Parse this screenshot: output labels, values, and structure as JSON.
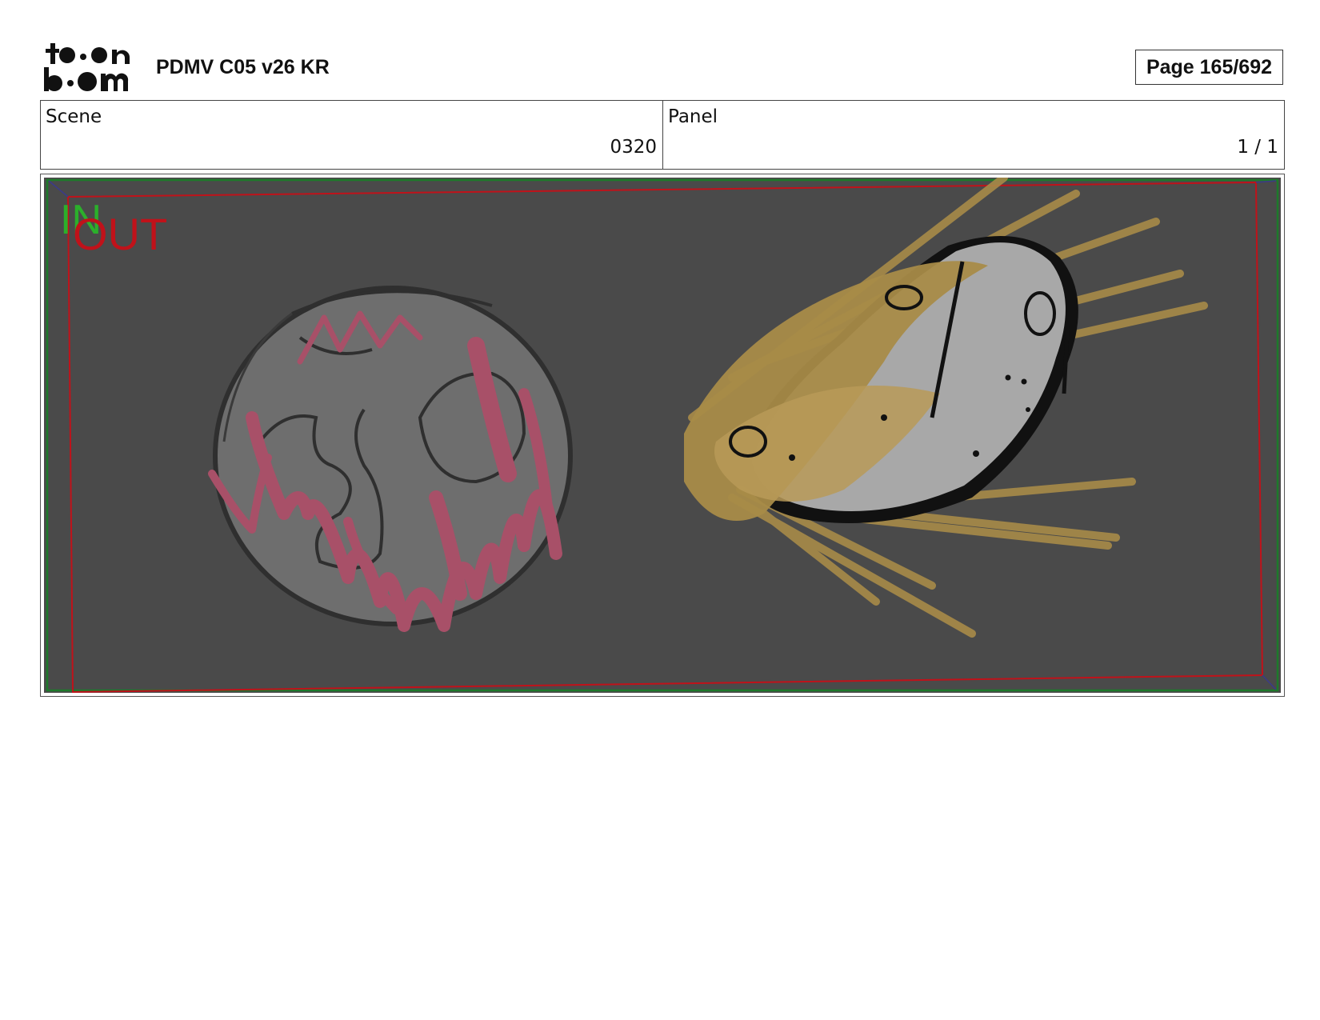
{
  "header": {
    "logo_text": "toon boom",
    "title": "PDMV C05 v26 KR",
    "page_label": "Page 165/692"
  },
  "info": {
    "scene_label": "Scene",
    "scene_value": "0320",
    "panel_label": "Panel",
    "panel_value": "1 / 1"
  },
  "panel_image": {
    "in_marker": "IN",
    "out_marker": "OUT",
    "colors": {
      "background": "#4a4a4a",
      "in_frame": "#1d7a2a",
      "out_frame": "#c0121a",
      "planet": "#6e6e6e",
      "planet_scribble": "#a85068",
      "comet_tail": "#a88b48",
      "asteroid": "#a8a8a8"
    }
  }
}
